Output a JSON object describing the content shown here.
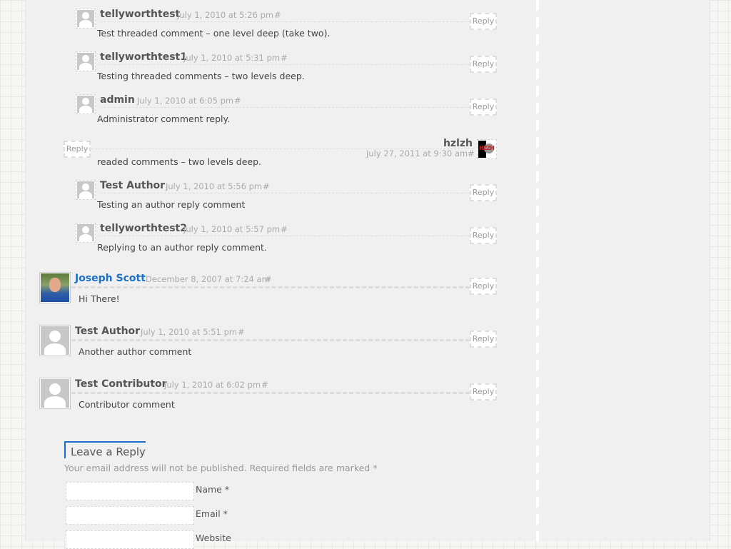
{
  "comments": [
    {
      "author": "tellyworthtest",
      "date": "July 1, 2010 at 5:26 pm",
      "permalink": "#",
      "text": "Test threaded comment – one level deep (take two).",
      "reply_label": "Reply"
    },
    {
      "author": "tellyworthtest1",
      "date": "July 1, 2010 at 5:31 pm",
      "permalink": "#",
      "text": "Testing threaded comments – two levels deep.",
      "reply_label": "Reply"
    },
    {
      "author": "admin",
      "date": "July 1, 2010 at 6:05 pm",
      "permalink": "#",
      "text": "Administrator comment reply.",
      "reply_label": "Reply"
    },
    {
      "author": "hzlzh",
      "date": "July 27, 2011 at 9:30 am",
      "permalink": "#",
      "text": "readed comments – two levels deep.",
      "reply_label": "Reply",
      "avatar_text": "HZZH"
    },
    {
      "author": "Test Author",
      "date": "July 1, 2010 at 5:56 pm",
      "permalink": "#",
      "text": "Testing an author reply comment",
      "reply_label": "Reply"
    },
    {
      "author": "tellyworthtest2",
      "date": "July 1, 2010 at 5:57 pm",
      "permalink": "#",
      "text": "Replying to an author reply comment.",
      "reply_label": "Reply"
    },
    {
      "author": "Joseph Scott",
      "date": "December 8, 2007 at 7:24 am",
      "permalink": "#",
      "text": "Hi There!",
      "reply_label": "Reply"
    },
    {
      "author": "Test Author",
      "date": "July 1, 2010 at 5:51 pm",
      "permalink": "#",
      "text": "Another author comment",
      "reply_label": "Reply"
    },
    {
      "author": "Test Contributor",
      "date": "July 1, 2010 at 6:02 pm",
      "permalink": "#",
      "text": "Contributor comment",
      "reply_label": "Reply"
    }
  ],
  "reply_form": {
    "title": "Leave a Reply",
    "notes": "Your email address will not be published. Required fields are marked *",
    "fields": [
      {
        "label": "Name *",
        "value": ""
      },
      {
        "label": "Email *",
        "value": ""
      },
      {
        "label": "Website",
        "value": ""
      }
    ]
  },
  "colors": {
    "link": "#1a6fc8",
    "background": "#f0f0f0"
  }
}
